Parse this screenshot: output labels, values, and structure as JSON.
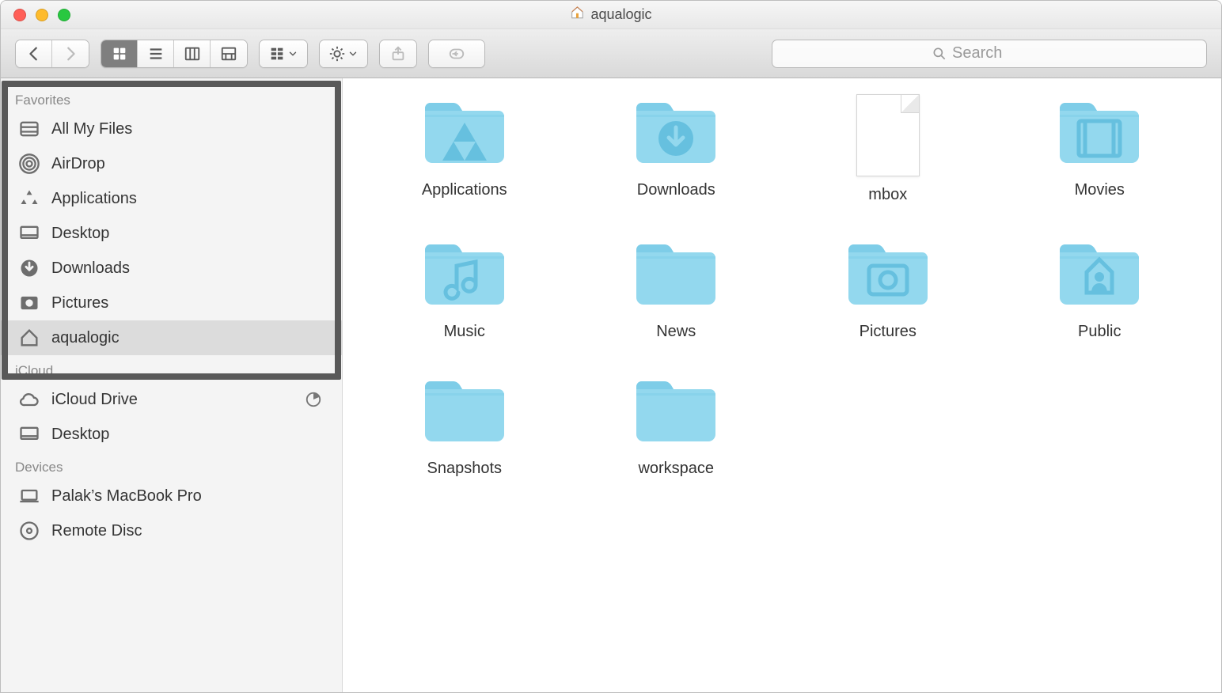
{
  "window_title": "aqualogic",
  "search_placeholder": "Search",
  "sidebar": {
    "favorites_header": "Favorites",
    "icloud_header": "iCloud",
    "devices_header": "Devices",
    "favorites": [
      {
        "label": "All My Files",
        "icon": "all-my-files-icon"
      },
      {
        "label": "AirDrop",
        "icon": "airdrop-icon"
      },
      {
        "label": "Applications",
        "icon": "applications-icon"
      },
      {
        "label": "Desktop",
        "icon": "desktop-icon"
      },
      {
        "label": "Downloads",
        "icon": "downloads-icon"
      },
      {
        "label": "Pictures",
        "icon": "pictures-icon"
      },
      {
        "label": "aqualogic",
        "icon": "home-icon",
        "selected": true
      }
    ],
    "icloud": [
      {
        "label": "iCloud Drive",
        "icon": "cloud-icon",
        "progress": true
      },
      {
        "label": "Desktop",
        "icon": "desktop-icon"
      }
    ],
    "devices": [
      {
        "label": "Palak’s MacBook Pro",
        "icon": "laptop-icon"
      },
      {
        "label": "Remote Disc",
        "icon": "disc-icon"
      }
    ]
  },
  "items": [
    {
      "label": "Applications",
      "type": "folder",
      "glyph": "app"
    },
    {
      "label": "Downloads",
      "type": "folder",
      "glyph": "download"
    },
    {
      "label": "mbox",
      "type": "file"
    },
    {
      "label": "Movies",
      "type": "folder",
      "glyph": "movie"
    },
    {
      "label": "Music",
      "type": "folder",
      "glyph": "music"
    },
    {
      "label": "News",
      "type": "folder",
      "glyph": ""
    },
    {
      "label": "Pictures",
      "type": "folder",
      "glyph": "picture"
    },
    {
      "label": "Public",
      "type": "folder",
      "glyph": "public"
    },
    {
      "label": "Snapshots",
      "type": "folder",
      "glyph": ""
    },
    {
      "label": "workspace",
      "type": "folder",
      "glyph": ""
    }
  ],
  "colors": {
    "folder_fill": "#93d8ee",
    "folder_tab": "#7ecde8",
    "folder_glyph": "#66c0df"
  }
}
